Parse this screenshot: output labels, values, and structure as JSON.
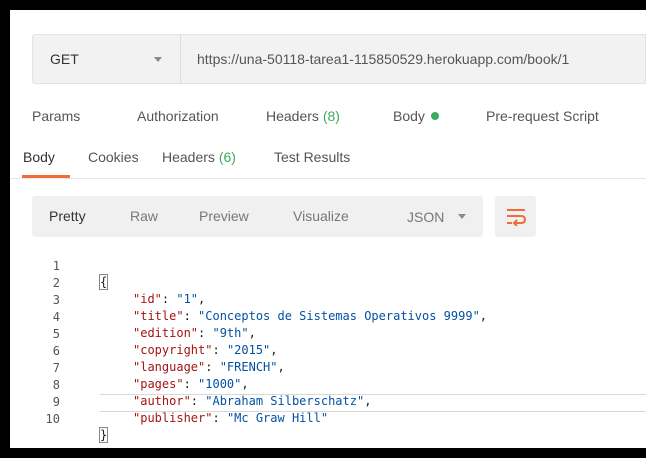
{
  "request": {
    "method": "GET",
    "url": "https://una-50118-tarea1-115850529.herokuapp.com/book/1"
  },
  "request_tabs": {
    "params": "Params",
    "authorization": "Authorization",
    "headers_label": "Headers",
    "headers_count": "(8)",
    "body": "Body",
    "prerequest": "Pre-request Script"
  },
  "response_tabs": {
    "body": "Body",
    "cookies": "Cookies",
    "headers_label": "Headers",
    "headers_count": "(6)",
    "test_results": "Test Results"
  },
  "view_toolbar": {
    "pretty": "Pretty",
    "raw": "Raw",
    "preview": "Preview",
    "visualize": "Visualize",
    "language": "JSON"
  },
  "code": {
    "line_numbers": [
      "1",
      "2",
      "3",
      "4",
      "5",
      "6",
      "7",
      "8",
      "9",
      "10"
    ],
    "open_brace": "{",
    "close_brace": "}",
    "fields": [
      {
        "key": "\"id\"",
        "value": "\"1\"",
        "sep": ","
      },
      {
        "key": "\"title\"",
        "value": "\"Conceptos de Sistemas Operativos 9999\"",
        "sep": ","
      },
      {
        "key": "\"edition\"",
        "value": "\"9th\"",
        "sep": ","
      },
      {
        "key": "\"copyright\"",
        "value": "\"2015\"",
        "sep": ","
      },
      {
        "key": "\"language\"",
        "value": "\"FRENCH\"",
        "sep": ","
      },
      {
        "key": "\"pages\"",
        "value": "\"1000\"",
        "sep": ","
      },
      {
        "key": "\"author\"",
        "value": "\"Abraham Silberschatz\"",
        "sep": ","
      },
      {
        "key": "\"publisher\"",
        "value": "\"Mc Graw Hill\"",
        "sep": ""
      }
    ]
  },
  "colors": {
    "accent": "#f26b3a",
    "success": "#3bab5c",
    "json_key": "#a31515",
    "json_string": "#0451a5"
  },
  "icons": {
    "method_dropdown": "chevron-down-icon",
    "language_dropdown": "chevron-down-icon",
    "wrap": "wrap-lines-icon",
    "body_status": "dot-icon"
  }
}
